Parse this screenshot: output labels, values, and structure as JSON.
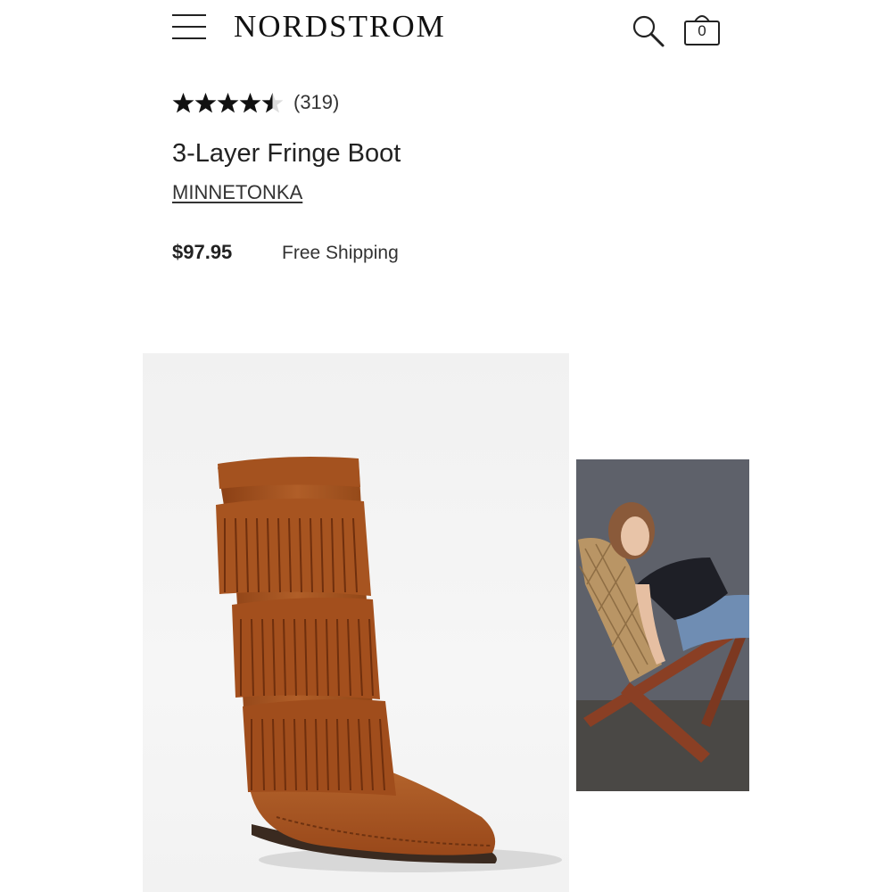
{
  "header": {
    "brand": "NORDSTROM",
    "menu_icon": "hamburger-menu-icon",
    "search_icon": "search-icon",
    "bag_icon": "shopping-bag-icon",
    "bag_count": "0"
  },
  "product": {
    "rating": 4.5,
    "rating_max": 5,
    "review_count": "(319)",
    "title": "3-Layer Fringe Boot",
    "brand": "MINNETONKA",
    "price": "$97.95",
    "shipping": "Free Shipping"
  },
  "gallery": {
    "images": [
      {
        "subject": "brown suede fringe boot product photo"
      },
      {
        "subject": "model seated in woven folding chair"
      }
    ]
  },
  "colors": {
    "text": "#222222",
    "boot": "#a4521f",
    "background": "#ffffff"
  }
}
